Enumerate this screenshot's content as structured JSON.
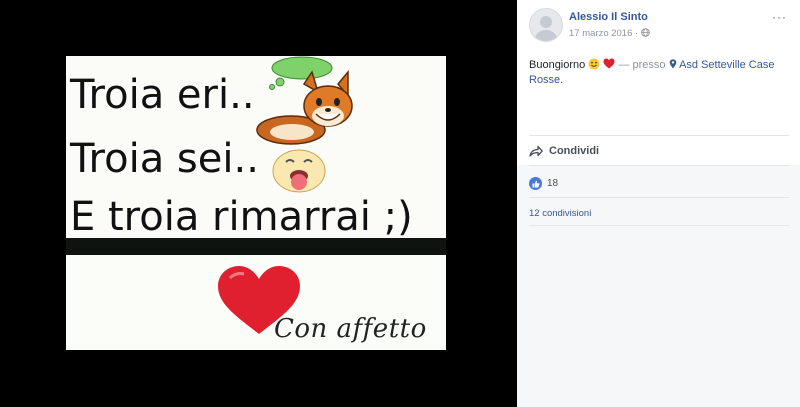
{
  "photo": {
    "line1": "Troia eri..",
    "line2": "Troia sei..",
    "line3": "E troia rimarrai ;)",
    "footer": "Con affetto"
  },
  "post": {
    "author": "Alessio Il Sinto",
    "date": "17 marzo 2016",
    "more_label": "···",
    "text": "Buongiorno",
    "presso": "— presso",
    "location": "Asd Setteville Case Rosse.",
    "share_label": "Condividi",
    "like_count": "18",
    "shares_label": "12 condivisioni"
  },
  "colors": {
    "link": "#365899",
    "like": "#4a78d8",
    "heart": "#e02030"
  }
}
